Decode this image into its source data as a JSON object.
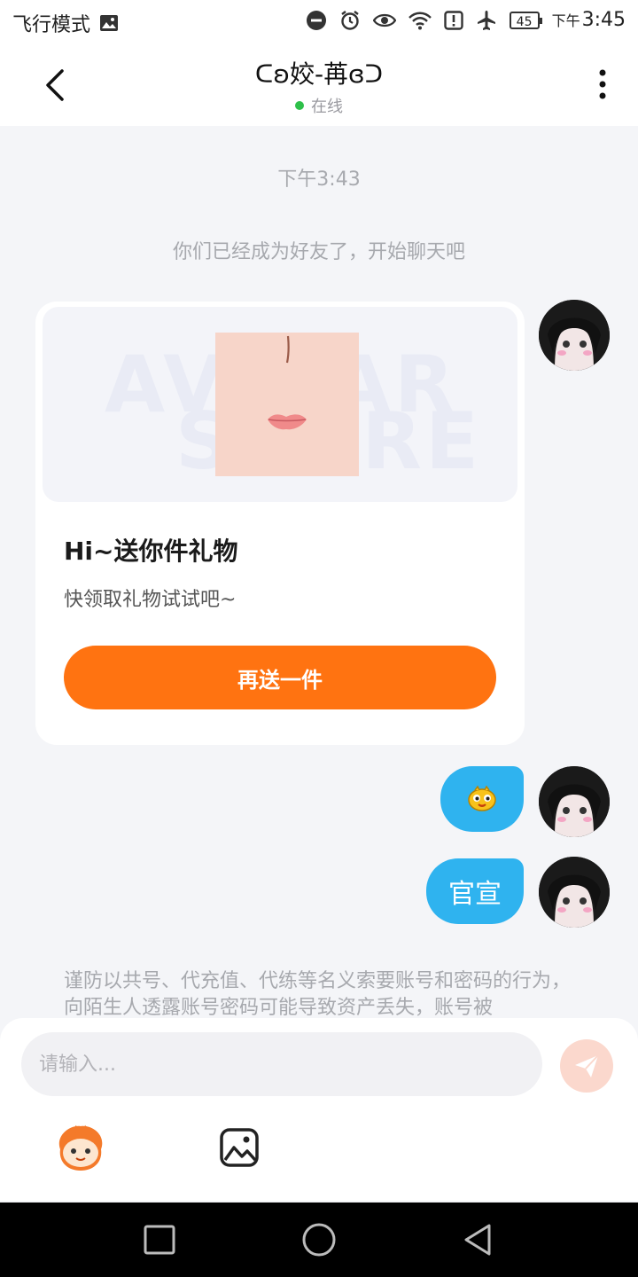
{
  "status_bar": {
    "airplane_text": "飞行模式",
    "time_prefix": "下午",
    "time": "3:45",
    "battery": "45",
    "icons": [
      "image-icon",
      "do-not-disturb-icon",
      "alarm-icon",
      "eye-icon",
      "wifi-icon",
      "alert-icon",
      "airplane-icon",
      "battery-icon"
    ]
  },
  "header": {
    "title": "ᑕʚ姣-苒ɞᑐ",
    "status": "在线",
    "online_color": "#2ec04a"
  },
  "chat": {
    "timestamp": "下午3:43",
    "friend_note": "你们已经成为好友了，开始聊天吧",
    "gift_card": {
      "watermark_top": "AVATAR",
      "watermark_bottom": "STORE",
      "title": "Hi~送你件礼物",
      "subtitle": "快领取礼物试试吧~",
      "button_label": "再送一件"
    },
    "messages": [
      {
        "type": "emoji",
        "emoji_name": "yellow-chick-emoji"
      },
      {
        "type": "text",
        "text": "官宣"
      }
    ],
    "notice": "谨防以共号、代充值、代练等名义索要账号和密码的行为，向陌生人透露账号密码可能导致资产丢失，账号被"
  },
  "input": {
    "placeholder": "请输入..."
  },
  "colors": {
    "accent": "#ff7311",
    "bubble": "#2fb3ef",
    "send_disabled": "#fbd8cd"
  }
}
